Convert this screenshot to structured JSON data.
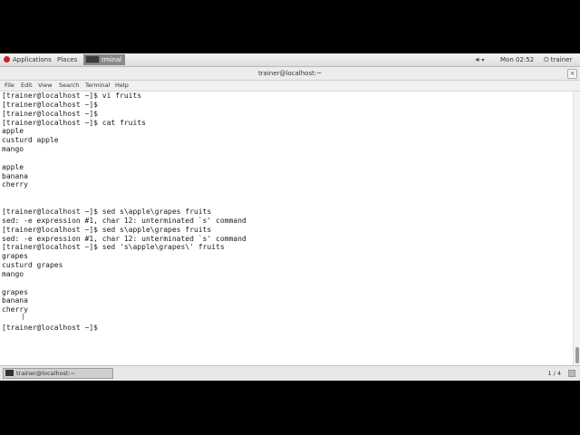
{
  "topbar": {
    "applications": "Applications",
    "places": "Places",
    "task_label": "rminal",
    "clock": "Mon 02:52",
    "user": "trainer",
    "icons": [
      "applications-icon",
      "terminal-icon",
      "volume-icon",
      "power-icon"
    ]
  },
  "window": {
    "title": "trainer@localhost:~",
    "close": "×"
  },
  "menubar": [
    "File",
    "Edit",
    "View",
    "Search",
    "Terminal",
    "Help"
  ],
  "terminal": {
    "lines": [
      "[trainer@localhost ~]$ vi fruits",
      "[trainer@localhost ~]$",
      "[trainer@localhost ~]$",
      "[trainer@localhost ~]$ cat fruits",
      "apple",
      "custurd apple",
      "mango",
      "",
      "apple",
      "banana",
      "cherry",
      "",
      "",
      "[trainer@localhost ~]$ sed s\\apple\\grapes fruits",
      "sed: -e expression #1, char 12: unterminated `s' command",
      "[trainer@localhost ~]$ sed s\\apple\\grapes fruits",
      "sed: -e expression #1, char 12: unterminated `s' command",
      "[trainer@localhost ~]$ sed 's\\apple\\grapes\\' fruits",
      "grapes",
      "custurd grapes",
      "mango",
      "",
      "grapes",
      "banana",
      "cherry",
      "",
      "[trainer@localhost ~]$"
    ]
  },
  "bottombar": {
    "task": "trainer@localhost:~",
    "workspace": "1 / 4"
  },
  "colors": {
    "terminal_bg": "#ffffff",
    "terminal_fg": "#1a1a1a",
    "panel_bg": "#e8e8e8",
    "apps_icon": "#cc2222"
  }
}
